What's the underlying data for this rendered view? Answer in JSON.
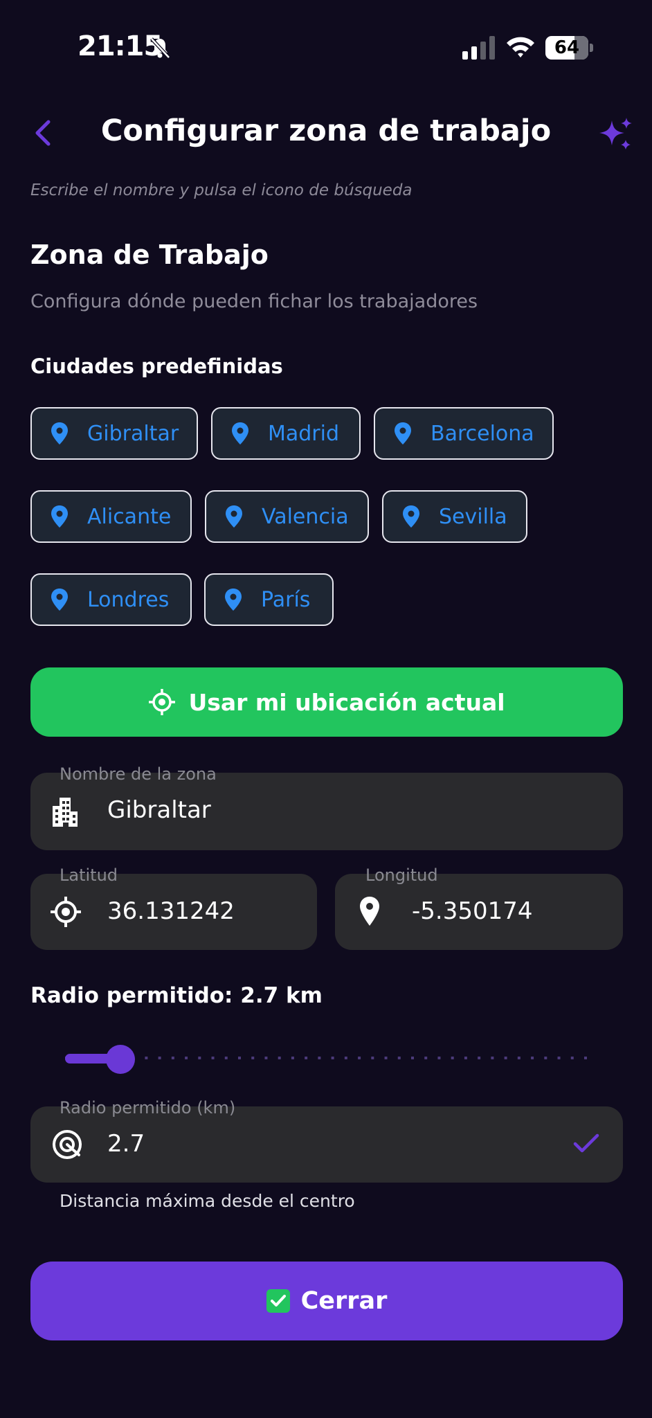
{
  "status_bar": {
    "time": "21:15",
    "battery": "64"
  },
  "header": {
    "title": "Configurar zona de trabajo",
    "hint": "Escribe el nombre y pulsa el icono de búsqueda"
  },
  "section": {
    "title": "Zona de Trabajo",
    "subtitle": "Configura dónde pueden fichar los trabajadores"
  },
  "cities": {
    "label": "Ciudades predefinidas",
    "items": [
      "Gibraltar",
      "Madrid",
      "Barcelona",
      "Alicante",
      "Valencia",
      "Sevilla",
      "Londres",
      "París"
    ]
  },
  "use_location_label": "Usar mi ubicación actual",
  "zone_name": {
    "label": "Nombre de la zona",
    "value": "Gibraltar"
  },
  "latitude": {
    "label": "Latitud",
    "value": "36.131242"
  },
  "longitude": {
    "label": "Longitud",
    "value": "-5.350174"
  },
  "radius": {
    "title": "Radio permitido: 2.7 km",
    "slider_fraction": 0.1,
    "field_label": "Radio permitido (km)",
    "value": "2.7",
    "helper": "Distancia máxima desde el centro"
  },
  "close_label": "Cerrar",
  "colors": {
    "background": "#0f0b1e",
    "accent_purple": "#6c3adb",
    "green": "#22c55e",
    "chip_text": "#2f8ff5",
    "field_bg": "#2a2a2d"
  }
}
